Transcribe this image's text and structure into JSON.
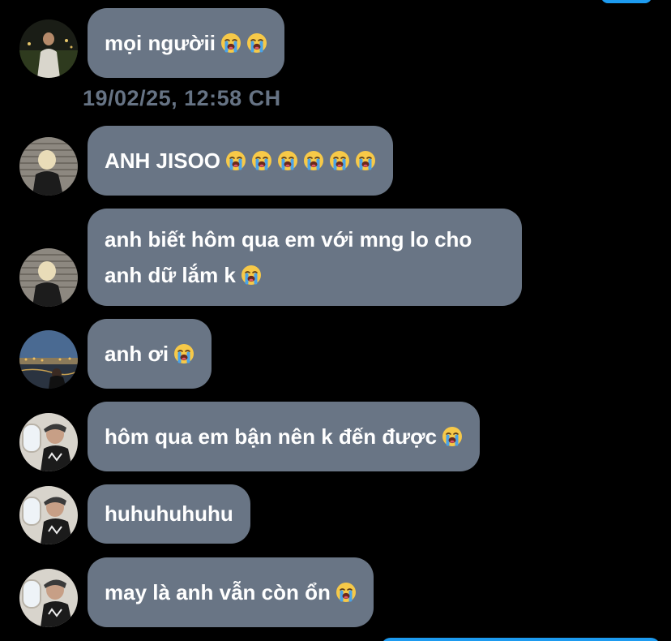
{
  "messages": [
    {
      "text": "mọi ngườii",
      "emoji_count": 2,
      "avatar": "avatar-night-city"
    },
    {
      "text": "ANH JISOO",
      "emoji_count": 6,
      "avatar": "avatar-blonde-blinds"
    },
    {
      "lines": [
        "anh biết hôm qua em với mng lo cho",
        "anh dữ lắm k"
      ],
      "emoji_count": 1,
      "avatar": "avatar-blonde-blinds"
    },
    {
      "text": "anh ơi",
      "emoji_count": 1,
      "avatar": "avatar-river-bridge"
    },
    {
      "text": "hôm qua em bận nên k đến được",
      "emoji_count": 1,
      "avatar": "avatar-airplane-window"
    },
    {
      "text": "huhuhuhuhu",
      "emoji_count": 0,
      "avatar": "avatar-airplane-window"
    },
    {
      "text": "may là anh vẫn còn ổn",
      "emoji_count": 1,
      "avatar": "avatar-airplane-window"
    }
  ],
  "timestamp": "19/02/25, 12:58 CH",
  "emoji_name": "loudly-crying-face-icon",
  "colors": {
    "background": "#000000",
    "bubble": "#697585",
    "timestamp": "#667384",
    "accent": "#1d9bf0"
  }
}
